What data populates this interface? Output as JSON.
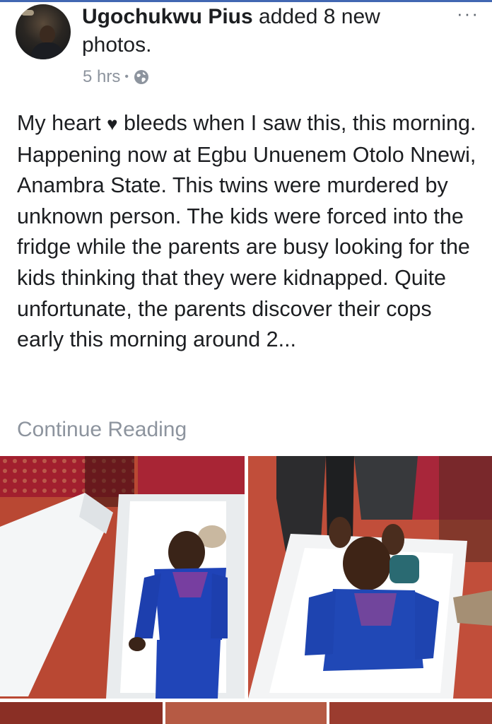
{
  "post": {
    "author": "Ugochukwu Pius",
    "action": "added 8 new photos.",
    "time": "5 hrs",
    "separator": "•",
    "more": "···",
    "body_lines": [
      {
        "before": "My heart ",
        "heart": "♥",
        "after": " bleeds when I saw this, this morning."
      },
      "Happening now at Egbu Unuenem Otolo Nnewi, Anambra State. This twins were murdered by unknown person. The kids were forced into the fridge while the parents are busy looking for the kids thinking that they were kidnapped. Quite unfortunate, the parents discover their cops early this morning around 2..."
    ],
    "continue_label": "Continue Reading"
  },
  "icons": {
    "globe": "globe-icon",
    "more": "more-options-icon",
    "heart": "heart-icon"
  },
  "colors": {
    "accent": "#4267b2",
    "text": "#1c1e21",
    "secondary_text": "#8d949e"
  }
}
